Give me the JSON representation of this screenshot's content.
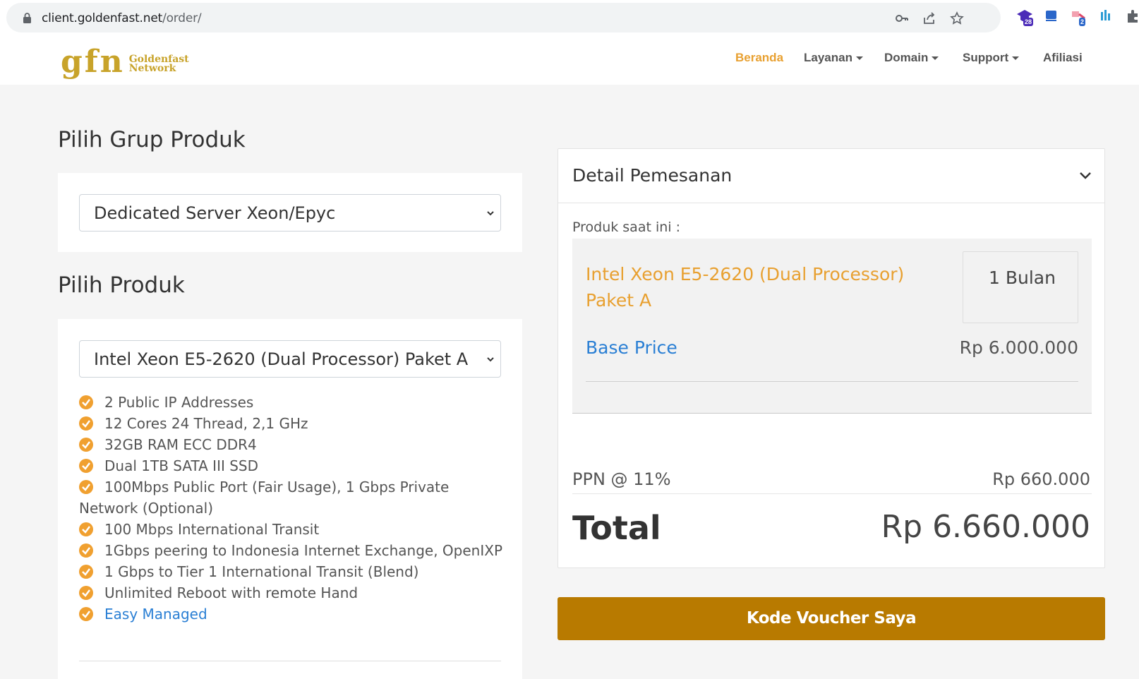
{
  "browser": {
    "url_host": "client.goldenfast.net",
    "url_path": "/order/",
    "icons": [
      "lock-icon",
      "key-icon",
      "share-icon",
      "star-icon",
      "puzzle-icon"
    ],
    "extensions": [
      {
        "name": "graduation-cap-extension-icon",
        "badge": "28",
        "color": "#4b2bb8"
      },
      {
        "name": "blue-tag-extension-icon",
        "badge": "",
        "color": "#2a66c9"
      },
      {
        "name": "pink-extension-icon",
        "badge": "2",
        "color": "#e04a6a"
      },
      {
        "name": "blue-bars-extension-icon",
        "badge": "",
        "color": "#2a9bd4"
      }
    ]
  },
  "header": {
    "logo_mark": "gfn",
    "logo_line1": "Goldenfast",
    "logo_line2": "Network",
    "nav": [
      {
        "label": "Beranda",
        "active": true,
        "dropdown": false
      },
      {
        "label": "Layanan",
        "active": false,
        "dropdown": true
      },
      {
        "label": "Domain",
        "active": false,
        "dropdown": true
      },
      {
        "label": "Support",
        "active": false,
        "dropdown": true
      },
      {
        "label": "Afiliasi",
        "active": false,
        "dropdown": false
      }
    ]
  },
  "left": {
    "group_heading": "Pilih Grup Produk",
    "group_select": "Dedicated Server Xeon/Epyc",
    "product_heading": "Pilih Produk",
    "product_select": "Intel Xeon E5-2620 (Dual Processor) Paket A",
    "features": [
      "2 Public IP Addresses",
      "12 Cores 24 Thread, 2,1 GHz",
      "32GB RAM ECC DDR4",
      "Dual 1TB SATA III SSD",
      "100Mbps Public Port (Fair Usage), 1 Gbps Private Network (Optional)",
      "100 Mbps International Transit",
      "1Gbps peering to Indonesia Internet Exchange, OpenIXP",
      "1 Gbps to Tier 1 International Transit (Blend)",
      "Unlimited Reboot with remote Hand",
      "Easy Managed"
    ]
  },
  "order": {
    "title": "Detail Pemesanan",
    "current_label": "Produk saat ini :",
    "product_name": "Intel Xeon E5-2620 (Dual Processor) Paket A",
    "quantity": "1 Bulan",
    "base_label": "Base Price",
    "base_value": "Rp 6.000.000",
    "ppn_label": "PPN @ 11%",
    "ppn_value": "Rp 660.000",
    "total_label": "Total",
    "total_value": "Rp 6.660.000",
    "voucher_button": "Kode Voucher Saya"
  },
  "colors": {
    "accent": "#e8a030",
    "link": "#2a7fd4",
    "button": "#b87a00",
    "logo": "#c8a32a"
  }
}
